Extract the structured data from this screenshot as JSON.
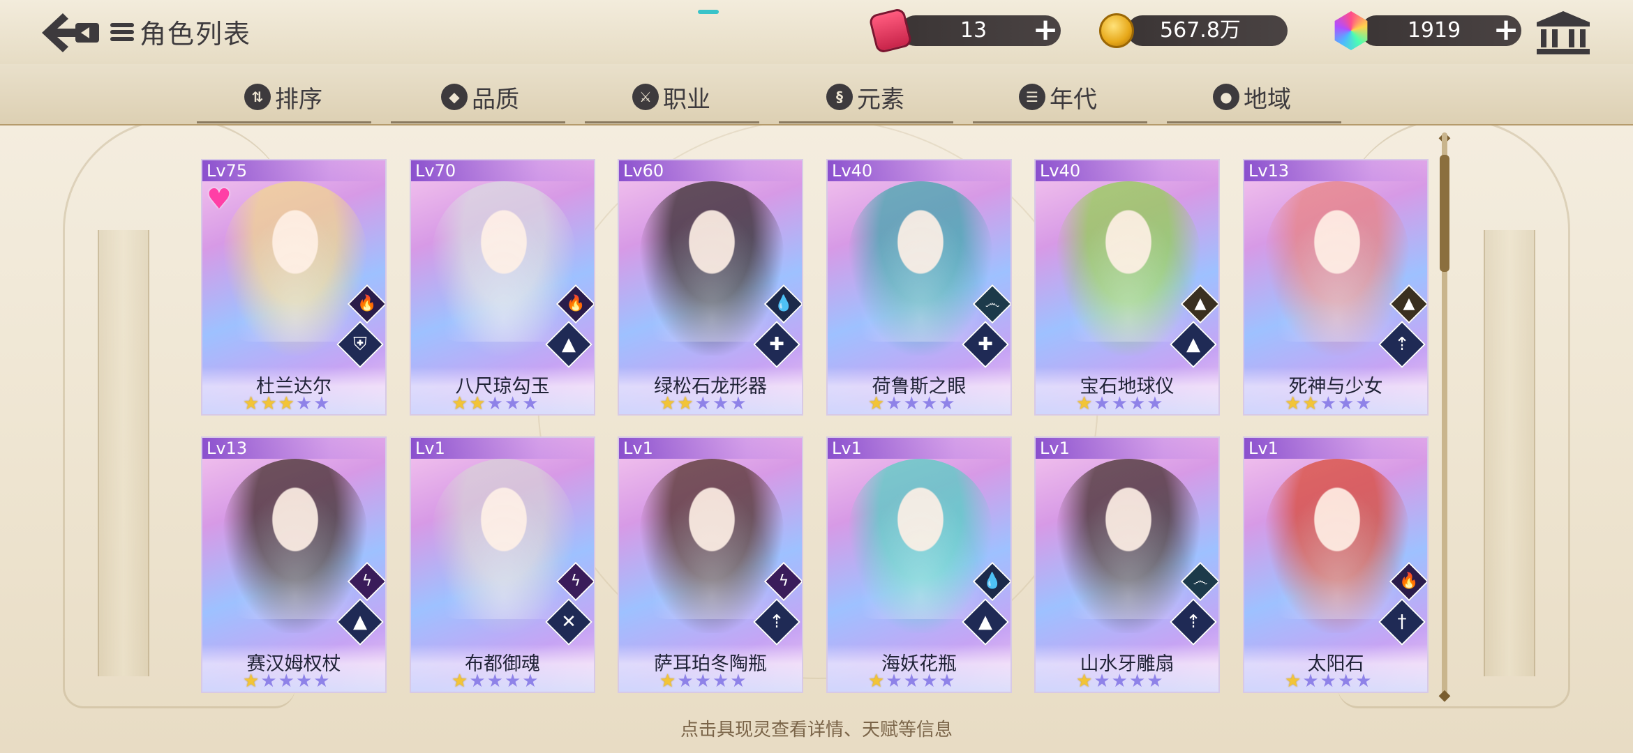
{
  "header": {
    "title": "角色列表",
    "resources": [
      {
        "name": "stamina",
        "icon": "energy-can-icon",
        "value": "13"
      },
      {
        "name": "gold",
        "icon": "gold-coin-icon",
        "value": "567.8万"
      },
      {
        "name": "gems",
        "icon": "rainbow-gem-icon",
        "value": "1919"
      }
    ]
  },
  "filters": [
    {
      "label": "排序",
      "icon": "sort-icon",
      "glyph": "⇅"
    },
    {
      "label": "品质",
      "icon": "quality-icon",
      "glyph": "◆"
    },
    {
      "label": "职业",
      "icon": "class-icon",
      "glyph": "⚔"
    },
    {
      "label": "元素",
      "icon": "element-icon",
      "glyph": "§"
    },
    {
      "label": "年代",
      "icon": "era-icon",
      "glyph": "☰"
    },
    {
      "label": "地域",
      "icon": "region-icon",
      "glyph": "●"
    }
  ],
  "cards": [
    {
      "level": "Lv75",
      "name": "杜兰达尔",
      "stars": 3,
      "favorite": true,
      "element": "fire",
      "element_glyph": "🔥",
      "element_color": "#2a1c4a",
      "class": "shield",
      "class_glyph": "⛨",
      "hair_color": "#f3d98a"
    },
    {
      "level": "Lv70",
      "name": "八尺琼勾玉",
      "stars": 2,
      "favorite": false,
      "element": "fire",
      "element_glyph": "🔥",
      "element_color": "#2a1c4a",
      "class": "book",
      "class_glyph": "▲",
      "hair_color": "#d9dde0"
    },
    {
      "level": "Lv60",
      "name": "绿松石龙形器",
      "stars": 2,
      "favorite": false,
      "element": "water",
      "element_glyph": "💧",
      "element_color": "#1c2a4a",
      "class": "cross",
      "class_glyph": "✚",
      "hair_color": "#2a2420"
    },
    {
      "level": "Lv40",
      "name": "荷鲁斯之眼",
      "stars": 1,
      "favorite": false,
      "element": "wind",
      "element_glyph": "෴",
      "element_color": "#1c3a4a",
      "class": "cross",
      "class_glyph": "✚",
      "hair_color": "#3ba7a9"
    },
    {
      "level": "Lv40",
      "name": "宝石地球仪",
      "stars": 1,
      "favorite": false,
      "element": "earth",
      "element_glyph": "▲",
      "element_color": "#3a3020",
      "class": "book",
      "class_glyph": "▲",
      "hair_color": "#8fd24a"
    },
    {
      "level": "Lv13",
      "name": "死神与少女",
      "stars": 2,
      "favorite": false,
      "element": "earth",
      "element_glyph": "▲",
      "element_color": "#3a3020",
      "class": "bow",
      "class_glyph": "⇡",
      "hair_color": "#e9837d"
    },
    {
      "level": "Lv13",
      "name": "赛汉姆权杖",
      "stars": 1,
      "favorite": false,
      "element": "thunder",
      "element_glyph": "ϟ",
      "element_color": "#3a1c5a",
      "class": "book",
      "class_glyph": "▲",
      "hair_color": "#3a2820"
    },
    {
      "level": "Lv1",
      "name": "布都御魂",
      "stars": 1,
      "favorite": false,
      "element": "thunder",
      "element_glyph": "ϟ",
      "element_color": "#3a1c5a",
      "class": "swords",
      "class_glyph": "✕",
      "hair_color": "#d7d3d6"
    },
    {
      "level": "Lv1",
      "name": "萨耳珀冬陶瓶",
      "stars": 1,
      "favorite": false,
      "element": "thunder",
      "element_glyph": "ϟ",
      "element_color": "#3a1c5a",
      "class": "bow",
      "class_glyph": "⇡",
      "hair_color": "#4a2c20"
    },
    {
      "level": "Lv1",
      "name": "海妖花瓶",
      "stars": 1,
      "favorite": false,
      "element": "water",
      "element_glyph": "💧",
      "element_color": "#1c2a4a",
      "class": "book",
      "class_glyph": "▲",
      "hair_color": "#4fd1c0"
    },
    {
      "level": "Lv1",
      "name": "山水牙雕扇",
      "stars": 1,
      "favorite": false,
      "element": "wind",
      "element_glyph": "෴",
      "element_color": "#1c3a4a",
      "class": "bow",
      "class_glyph": "⇡",
      "hair_color": "#3b2a22"
    },
    {
      "level": "Lv1",
      "name": "太阳石",
      "stars": 1,
      "favorite": false,
      "element": "fire",
      "element_glyph": "🔥",
      "element_color": "#2a1c4a",
      "class": "sword",
      "class_glyph": "†",
      "hair_color": "#d9462c"
    }
  ],
  "max_stars": 5,
  "hint": "点击具现灵查看详情、天赋等信息"
}
